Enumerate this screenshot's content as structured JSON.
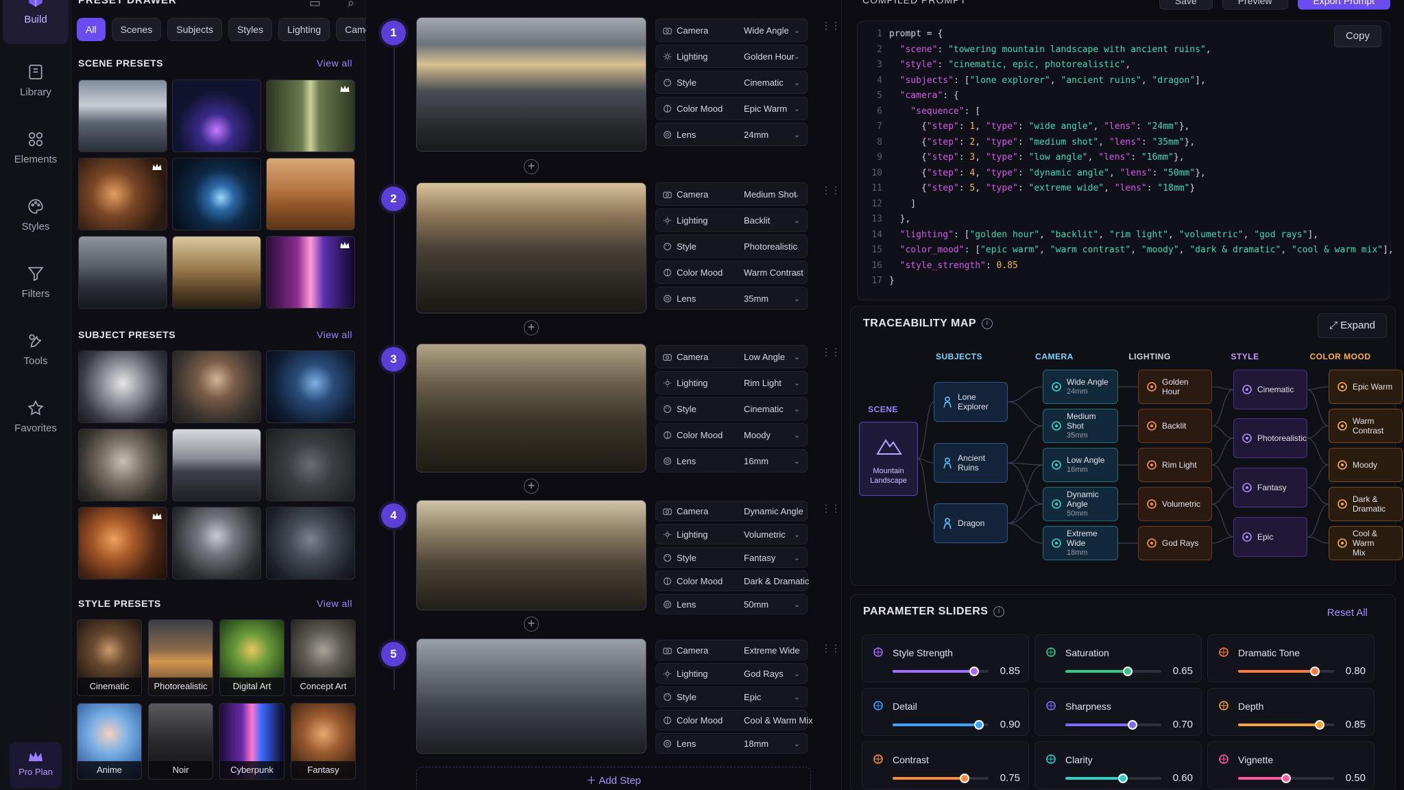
{
  "nav": {
    "items": [
      {
        "label": "Build",
        "icon": "cube-icon"
      },
      {
        "label": "Library",
        "icon": "library-icon"
      },
      {
        "label": "Elements",
        "icon": "elements-icon"
      },
      {
        "label": "Styles",
        "icon": "palette-icon"
      },
      {
        "label": "Filters",
        "icon": "filter-icon"
      },
      {
        "label": "Tools",
        "icon": "tools-icon"
      },
      {
        "label": "Favorites",
        "icon": "star-icon"
      }
    ],
    "pro_label": "Pro Plan"
  },
  "drawer": {
    "title": "PRESET DRAWER",
    "filters": [
      "All",
      "Scenes",
      "Subjects",
      "Styles",
      "Lighting",
      "Camera"
    ],
    "active_filter": "All",
    "scene_title": "SCENE PRESETS",
    "subject_title": "SUBJECT PRESETS",
    "style_title": "STYLE PRESETS",
    "view_all": "View all",
    "styles": [
      "Cinematic",
      "Photorealistic",
      "Digital Art",
      "Concept Art",
      "Anime",
      "Noir",
      "Cyberpunk",
      "Fantasy"
    ]
  },
  "steps": [
    {
      "num": "1",
      "params": [
        [
          "Camera",
          "Wide Angle"
        ],
        [
          "Lighting",
          "Golden Hour"
        ],
        [
          "Style",
          "Cinematic"
        ],
        [
          "Color Mood",
          "Epic Warm"
        ],
        [
          "Lens",
          "24mm"
        ]
      ]
    },
    {
      "num": "2",
      "params": [
        [
          "Camera",
          "Medium Shot"
        ],
        [
          "Lighting",
          "Backlit"
        ],
        [
          "Style",
          "Photorealistic"
        ],
        [
          "Color Mood",
          "Warm Contrast"
        ],
        [
          "Lens",
          "35mm"
        ]
      ]
    },
    {
      "num": "3",
      "params": [
        [
          "Camera",
          "Low Angle"
        ],
        [
          "Lighting",
          "Rim Light"
        ],
        [
          "Style",
          "Cinematic"
        ],
        [
          "Color Mood",
          "Moody"
        ],
        [
          "Lens",
          "16mm"
        ]
      ]
    },
    {
      "num": "4",
      "params": [
        [
          "Camera",
          "Dynamic Angle"
        ],
        [
          "Lighting",
          "Volumetric"
        ],
        [
          "Style",
          "Fantasy"
        ],
        [
          "Color Mood",
          "Dark & Dramatic"
        ],
        [
          "Lens",
          "50mm"
        ]
      ]
    },
    {
      "num": "5",
      "params": [
        [
          "Camera",
          "Extreme Wide"
        ],
        [
          "Lighting",
          "God Rays"
        ],
        [
          "Style",
          "Epic"
        ],
        [
          "Color Mood",
          "Cool & Warm Mix"
        ],
        [
          "Lens",
          "18mm"
        ]
      ]
    }
  ],
  "add_step_label": "Add Step",
  "header": {
    "compiled_label": "COMPILED PROMPT",
    "buttons": [
      "Save",
      "Preview",
      "Export Prompt"
    ]
  },
  "code": {
    "copy_label": "Copy",
    "lines": [
      "prompt = {",
      "  \"scene\": \"towering mountain landscape with ancient ruins\",",
      "  \"style\": \"cinematic, epic, photorealistic\",",
      "  \"subjects\": [\"lone explorer\", \"ancient ruins\", \"dragon\"],",
      "  \"camera\": {",
      "    \"sequence\": [",
      "      {\"step\": 1, \"type\": \"wide angle\", \"lens\": \"24mm\"},",
      "      {\"step\": 2, \"type\": \"medium shot\", \"lens\": \"35mm\"},",
      "      {\"step\": 3, \"type\": \"low angle\", \"lens\": \"16mm\"},",
      "      {\"step\": 4, \"type\": \"dynamic angle\", \"lens\": \"50mm\"},",
      "      {\"step\": 5, \"type\": \"extreme wide\", \"lens\": \"18mm\"}",
      "    ]",
      "  },",
      "  \"lighting\": [\"golden hour\", \"backlit\", \"rim light\", \"volumetric\", \"god rays\"],",
      "  \"color_mood\": [\"epic warm\", \"warm contrast\", \"moody\", \"dark & dramatic\", \"cool & warm mix\"],",
      "  \"style_strength\": 0.85",
      "}"
    ]
  },
  "trace": {
    "title": "TRACEABILITY MAP",
    "expand_label": "Expand",
    "col_heads": {
      "scene": "SCENE",
      "subjects": "SUBJECTS",
      "camera": "CAMERA",
      "lighting": "LIGHTING",
      "style": "STYLE",
      "color": "COLOR MOOD"
    },
    "scene": [
      "Mountain",
      "Landscape"
    ],
    "subjects": [
      "Lone Explorer",
      "Ancient Ruins",
      "Dragon"
    ],
    "camera": [
      [
        "Wide Angle",
        "24mm"
      ],
      [
        "Medium Shot",
        "35mm"
      ],
      [
        "Low Angle",
        "16mm"
      ],
      [
        "Dynamic Angle",
        "50mm"
      ],
      [
        "Extreme Wide",
        "18mm"
      ]
    ],
    "lighting": [
      "Golden Hour",
      "Backlit",
      "Rim Light",
      "Volumetric",
      "God Rays"
    ],
    "style": [
      "Cinematic",
      "Photorealistic",
      "Fantasy",
      "Epic"
    ],
    "color": [
      [
        "Epic Warm"
      ],
      [
        "Warm",
        "Contrast"
      ],
      [
        "Moody"
      ],
      [
        "Dark &",
        "Dramatic"
      ],
      [
        "Cool & Warm",
        "Mix"
      ]
    ]
  },
  "sliders": {
    "title": "PARAMETER SLIDERS",
    "reset_label": "Reset All",
    "items": [
      {
        "name": "Style Strength",
        "value": "0.85",
        "level": 0.85,
        "color": "#a36cff"
      },
      {
        "name": "Saturation",
        "value": "0.65",
        "level": 0.65,
        "color": "#31c98a"
      },
      {
        "name": "Dramatic Tone",
        "value": "0.80",
        "level": 0.8,
        "color": "#ff7a3c"
      },
      {
        "name": "Detail",
        "value": "0.90",
        "level": 0.9,
        "color": "#3aa2ff"
      },
      {
        "name": "Sharpness",
        "value": "0.70",
        "level": 0.7,
        "color": "#7b6cff"
      },
      {
        "name": "Depth",
        "value": "0.85",
        "level": 0.85,
        "color": "#f5a43a"
      },
      {
        "name": "Contrast",
        "value": "0.75",
        "level": 0.75,
        "color": "#ff8a3c"
      },
      {
        "name": "Clarity",
        "value": "0.60",
        "level": 0.6,
        "color": "#2fd0c4"
      },
      {
        "name": "Vignette",
        "value": "0.50",
        "level": 0.5,
        "color": "#ff5aa0"
      }
    ]
  }
}
